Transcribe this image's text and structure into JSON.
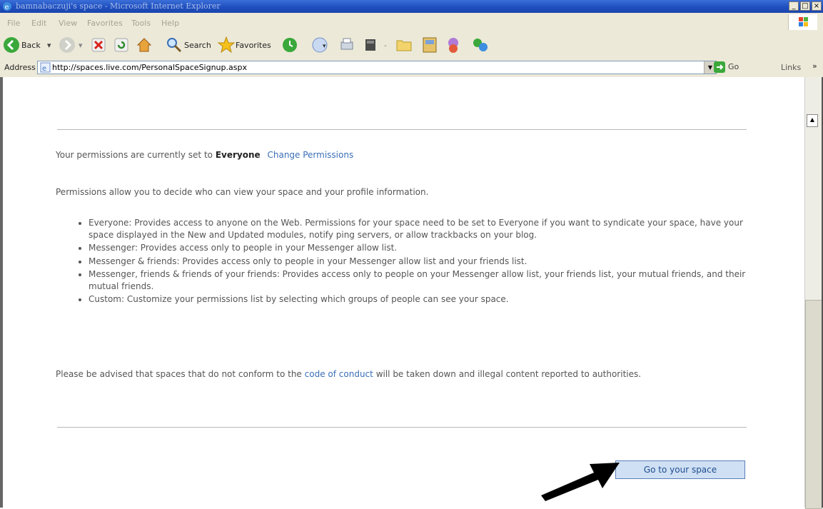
{
  "window": {
    "title": "bamnabaczuji's space - Microsoft Internet Explorer",
    "minimize": "_",
    "maximize": "□",
    "close": "×"
  },
  "menu": [
    "File",
    "Edit",
    "View",
    "Favorites",
    "Tools",
    "Help"
  ],
  "toolbar": {
    "back": "Back",
    "search": "Search",
    "favorites": "Favorites"
  },
  "address": {
    "label": "Address",
    "url": "http://spaces.live.com/PersonalSpaceSignup.aspx",
    "go": "Go",
    "links": "Links"
  },
  "page": {
    "permissions_prefix": "Your permissions are currently set to",
    "permissions_value": "Everyone",
    "change_permissions": "Change Permissions",
    "intro": "Permissions allow you to decide who can view your space and your profile information.",
    "options": [
      "Everyone: Provides access to anyone on the Web. Permissions for your space need to be set to Everyone if you want to syndicate your space, have your space displayed in the New and Updated modules, notify ping servers, or allow trackbacks on your blog.",
      "Messenger: Provides access only to people in your Messenger allow list.",
      "Messenger & friends: Provides access only to people in your Messenger allow list and your friends list.",
      "Messenger, friends & friends of your friends: Provides access only to people on your Messenger allow list, your friends list, your mutual friends, and their mutual friends.",
      "Custom: Customize your permissions list by selecting which groups of people can see your space."
    ],
    "advisory_prefix": "Please be advised that spaces that do not conform to the",
    "code_of_conduct": "code of conduct",
    "advisory_suffix": "will be taken down and illegal content reported to authorities.",
    "go_button": "Go to your space"
  },
  "colors": {
    "link": "#3a6fb5",
    "button_bg": "#cfe0f4",
    "chrome": "#ece9d8",
    "titlebar": "#1f4fbf"
  },
  "icons": [
    "ie-icon",
    "back-icon",
    "forward-icon",
    "stop-icon",
    "refresh-icon",
    "home-icon",
    "search-icon",
    "favorites-star-icon",
    "history-icon",
    "mail-icon",
    "print-icon",
    "edit-icon",
    "folder-icon",
    "messenger-icon",
    "windows-logo-icon",
    "arrow-pointer-icon"
  ]
}
